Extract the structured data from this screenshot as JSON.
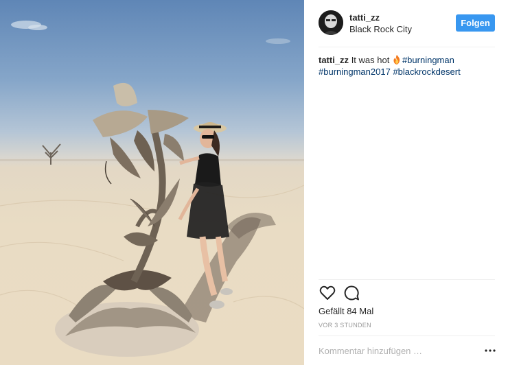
{
  "photo": {
    "description_icon": "burning-man-sculpture-photo"
  },
  "header": {
    "username": "tatti_zz",
    "location": "Black Rock City",
    "follow_label": "Folgen"
  },
  "caption": {
    "username": "tatti_zz",
    "text": "It was hot",
    "emoji_icon": "fire-icon",
    "hashtags": [
      "#burningman",
      "#burningman2017",
      "#blackrockdesert"
    ]
  },
  "actions": {
    "like_icon": "heart-icon",
    "comment_icon": "comment-bubble-icon"
  },
  "likes": {
    "prefix": "Gefällt",
    "count": "84",
    "suffix": "Mal"
  },
  "timestamp": "VOR 3 STUNDEN",
  "comment_box": {
    "placeholder": "Kommentar hinzufügen …",
    "more_icon": "ellipsis-icon"
  },
  "colors": {
    "follow_button": "#3897f0",
    "hashtag": "#003569",
    "timestamp": "#999999"
  }
}
